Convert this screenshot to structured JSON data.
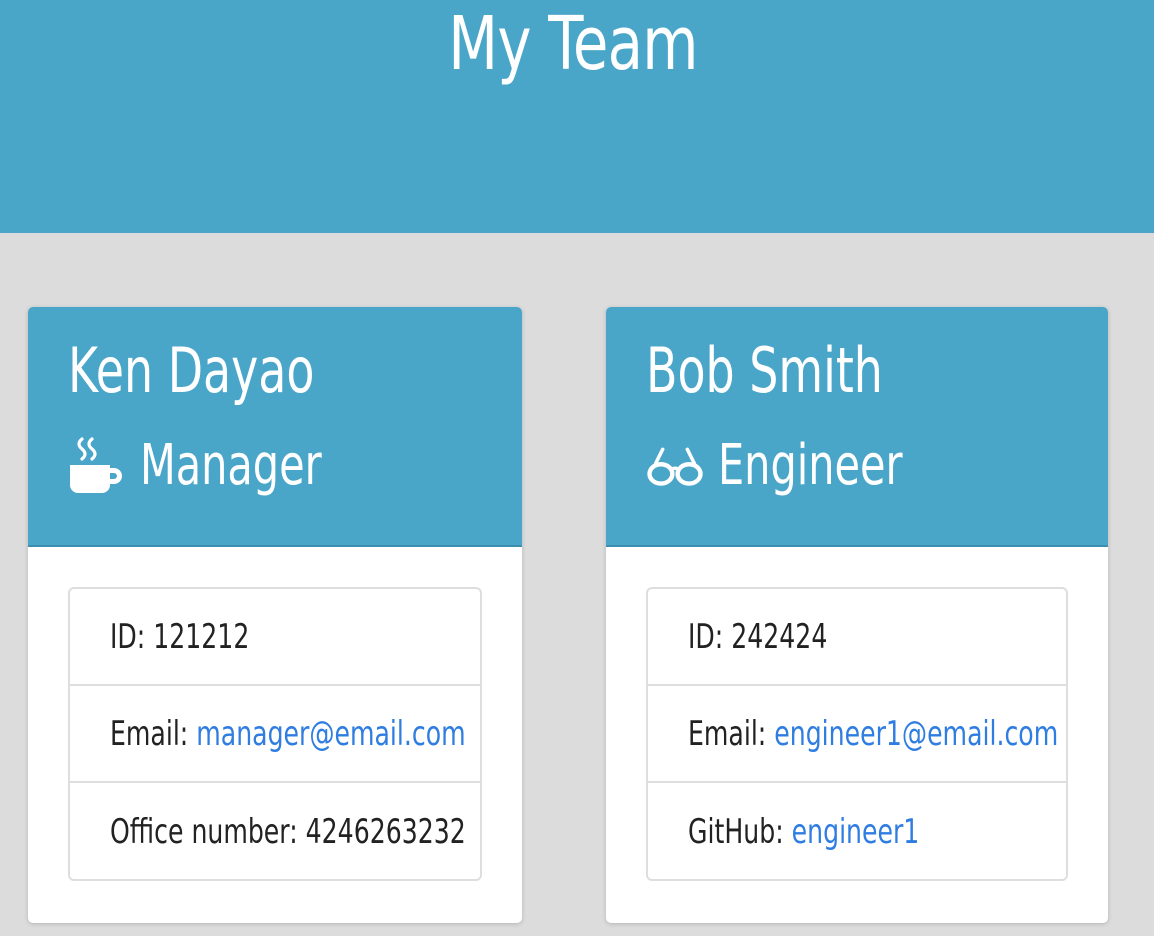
{
  "header": {
    "title": "My Team"
  },
  "team": [
    {
      "name": "Ken Dayao",
      "role": "Manager",
      "role_icon": "coffee-mug-icon",
      "id_label": "ID: ",
      "id_value": "121212",
      "email_label": "Email: ",
      "email_value": "manager@email.com",
      "extra_label": "Office number: ",
      "extra_value": "4246263232"
    },
    {
      "name": "Bob Smith",
      "role": "Engineer",
      "role_icon": "glasses-icon",
      "id_label": "ID: ",
      "id_value": "242424",
      "email_label": "Email: ",
      "email_value": "engineer1@email.com",
      "extra_label": "GitHub: ",
      "extra_value": "engineer1"
    }
  ],
  "colors": {
    "header_bg": "#4aa6c9",
    "page_bg": "#dcdcdc",
    "link": "#2f7de1",
    "text": "#222222"
  }
}
